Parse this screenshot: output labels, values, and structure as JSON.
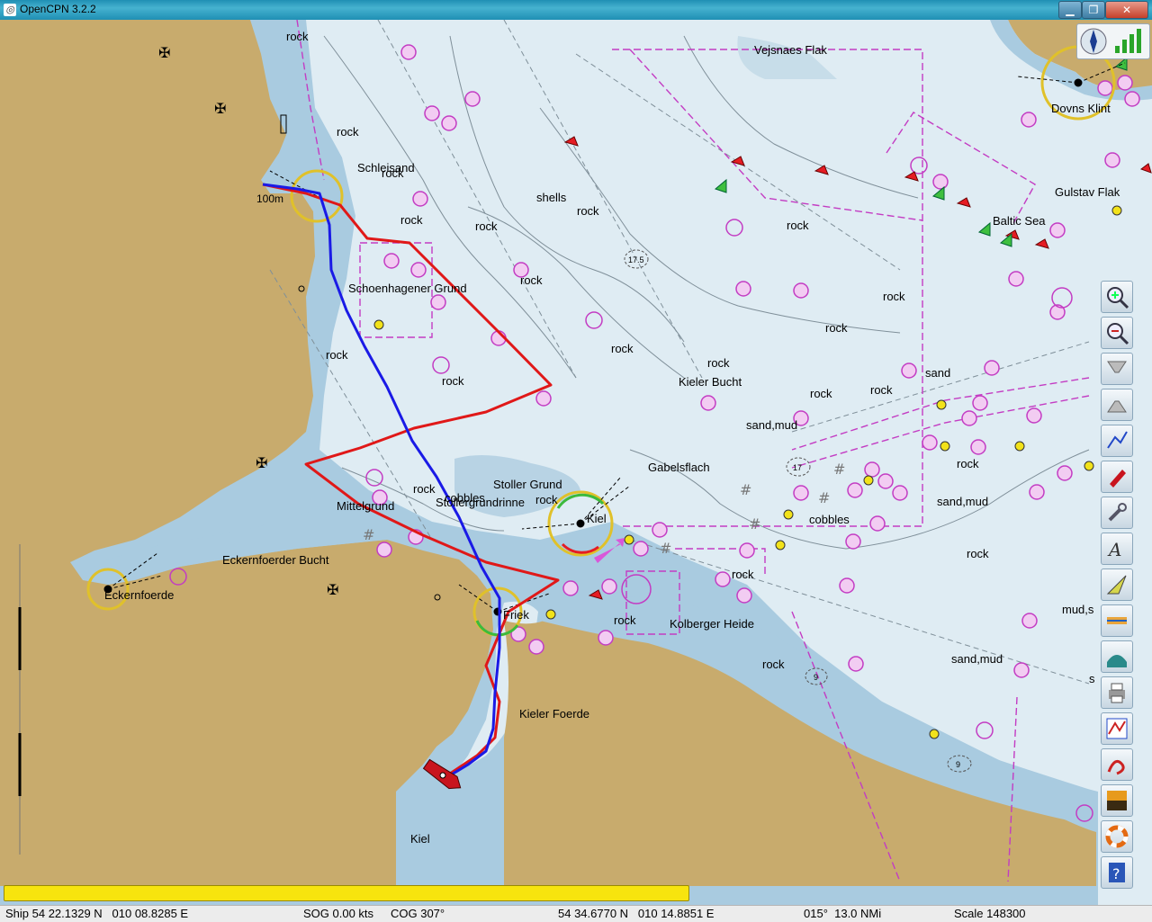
{
  "window": {
    "title": "OpenCPN 3.2.2"
  },
  "map_labels": [
    {
      "id": "rock-1",
      "text": "rock"
    },
    {
      "id": "vejsnaes",
      "text": "Vejsnaes Flak"
    },
    {
      "id": "rock-2",
      "text": "rock"
    },
    {
      "id": "schleisand",
      "text": "Schleisand"
    },
    {
      "id": "rock-3",
      "text": "rock"
    },
    {
      "id": "shells",
      "text": "shells"
    },
    {
      "id": "rock-4",
      "text": "rock"
    },
    {
      "id": "rock-5",
      "text": "rock"
    },
    {
      "id": "rock-6",
      "text": "rock"
    },
    {
      "id": "rock-7",
      "text": "rock"
    },
    {
      "id": "rock-8",
      "text": "rock"
    },
    {
      "id": "schoenhagener",
      "text": "Schoenhagener Grund"
    },
    {
      "id": "rock-9",
      "text": "rock"
    },
    {
      "id": "rock-10",
      "text": "rock"
    },
    {
      "id": "rock-11",
      "text": "rock"
    },
    {
      "id": "rock-12",
      "text": "rock"
    },
    {
      "id": "kieler-bucht",
      "text": "Kieler Bucht"
    },
    {
      "id": "rock-13",
      "text": "rock"
    },
    {
      "id": "rock-14",
      "text": "rock"
    },
    {
      "id": "sand",
      "text": "sand"
    },
    {
      "id": "rock-15",
      "text": "rock"
    },
    {
      "id": "sand-mud-1",
      "text": "sand,mud"
    },
    {
      "id": "rock-16",
      "text": "rock"
    },
    {
      "id": "gabelsflach",
      "text": "Gabelsflach"
    },
    {
      "id": "stoller-grund",
      "text": "Stoller Grund"
    },
    {
      "id": "rock-17",
      "text": "rock"
    },
    {
      "id": "cobbles-1",
      "text": "cobbles"
    },
    {
      "id": "stollergrundrinne",
      "text": "Stollergrundrinne"
    },
    {
      "id": "rock-18",
      "text": "rock"
    },
    {
      "id": "mittelgrund",
      "text": "Mittelgrund"
    },
    {
      "id": "kiel-label",
      "text": "Kiel"
    },
    {
      "id": "cobbles-2",
      "text": "cobbles"
    },
    {
      "id": "rock-19",
      "text": "rock"
    },
    {
      "id": "sand-mud-2",
      "text": "sand,mud"
    },
    {
      "id": "eckernfoerder-bucht",
      "text": "Eckernfoerder Bucht"
    },
    {
      "id": "rock-20",
      "text": "rock"
    },
    {
      "id": "rock-21",
      "text": "rock"
    },
    {
      "id": "eckernfoerde",
      "text": "Eckernfoerde"
    },
    {
      "id": "friek",
      "text": "Friek"
    },
    {
      "id": "rock-22",
      "text": "rock"
    },
    {
      "id": "kolberger",
      "text": "Kolberger Heide"
    },
    {
      "id": "mud-s",
      "text": "mud,s"
    },
    {
      "id": "rock-23",
      "text": "rock"
    },
    {
      "id": "sand-mud-3",
      "text": "sand,mud"
    },
    {
      "id": "s-letter",
      "text": "s"
    },
    {
      "id": "kieler-foerde",
      "text": "Kieler Foerde"
    },
    {
      "id": "kiel-city",
      "text": "Kiel"
    },
    {
      "id": "dovns-klint",
      "text": "Dovns Klint"
    },
    {
      "id": "gulstav",
      "text": "Gulstav Flak"
    },
    {
      "id": "baltic",
      "text": "Baltic Sea"
    },
    {
      "id": "dist-100m",
      "text": "100m"
    },
    {
      "id": "depth-175",
      "text": "17.5"
    },
    {
      "id": "depth-17",
      "text": "17"
    },
    {
      "id": "depth-9a",
      "text": "9"
    },
    {
      "id": "depth-9b",
      "text": "9"
    }
  ],
  "status": {
    "ship": "Ship 54 22.1329 N   010 08.8285 E",
    "sog": "SOG 0.00 kts",
    "cog": "COG 307°",
    "cursor": "54 34.6770 N   010 14.8851 E",
    "bearing": "015°  13.0 NMi",
    "scale": "Scale 148300"
  },
  "toolbar": [
    "zoom-in",
    "zoom-out",
    "scale-in",
    "scale-out",
    "route",
    "ship-follow",
    "settings",
    "text-overlay",
    "current",
    "tide",
    "print",
    "route-manager",
    "track",
    "color-scheme",
    "mob",
    "help"
  ],
  "progress_fraction": 0.59,
  "colors": {
    "sea": "#dfecf3",
    "shallow": "#a9cbe0",
    "mid": "#c7dde9",
    "land": "#c8ab6d",
    "red_track": "#e01818",
    "blue_track": "#1a1ae6",
    "magenta": "#c33cc3"
  }
}
